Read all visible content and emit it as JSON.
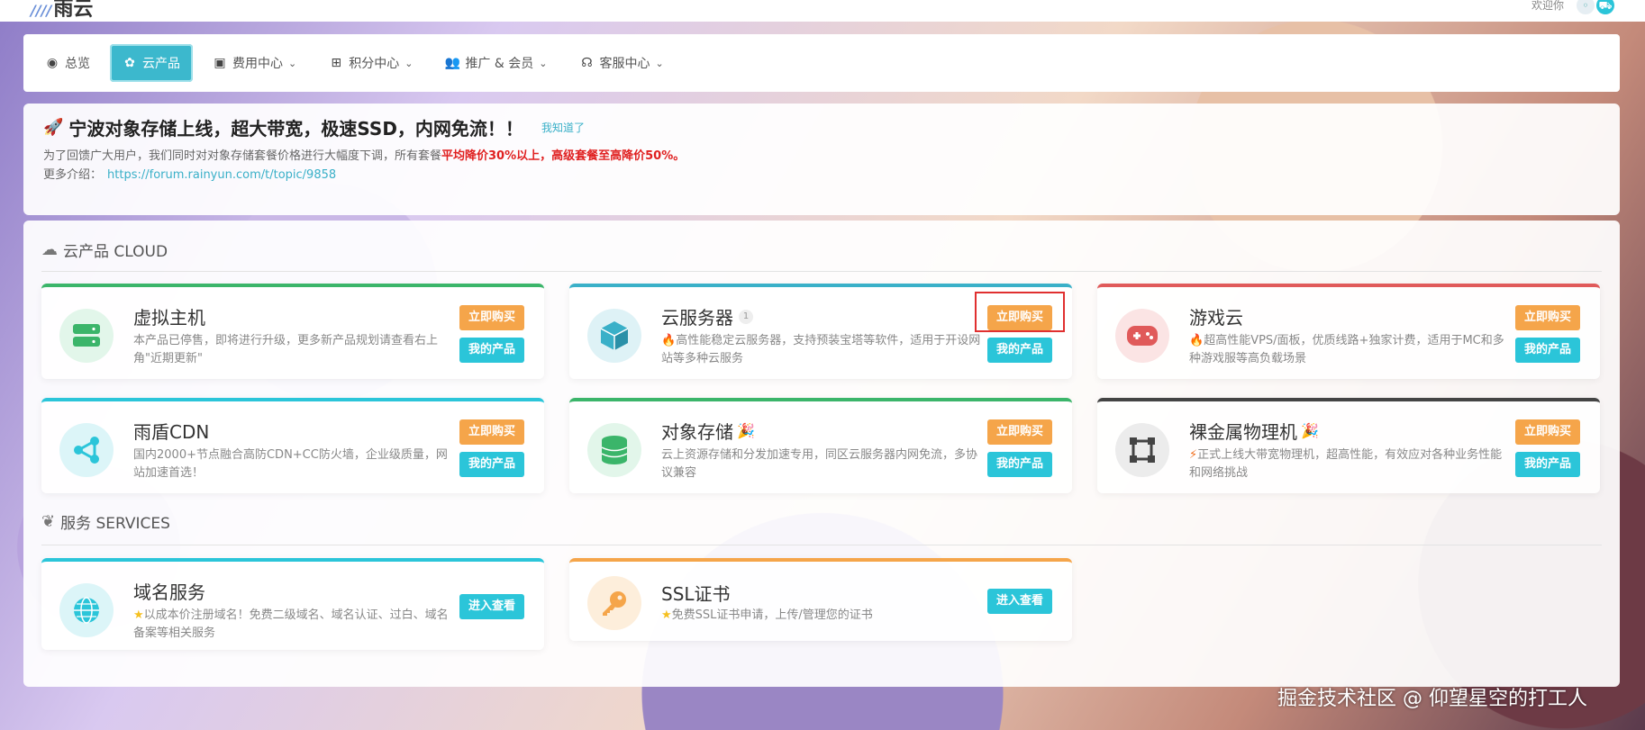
{
  "brand": {
    "logo_text": "雨云",
    "stripes": "////"
  },
  "header": {
    "welcome": "欢迎你"
  },
  "nav": {
    "items": [
      {
        "label": "总览",
        "icon": "dashboard-icon",
        "chevron": false
      },
      {
        "label": "云产品",
        "icon": "cloud-products-icon",
        "chevron": false,
        "active": true
      },
      {
        "label": "费用中心",
        "icon": "money-icon",
        "chevron": true
      },
      {
        "label": "积分中心",
        "icon": "gift-icon",
        "chevron": true
      },
      {
        "label": "推广 & 会员",
        "icon": "users-icon",
        "chevron": true
      },
      {
        "label": "客服中心",
        "icon": "headset-icon",
        "chevron": true
      }
    ]
  },
  "notice": {
    "title": "宁波对象存储上线，超大带宽，极速SSD，内网免流！！",
    "dismiss": "我知道了",
    "line1_prefix": "为了回馈广大用户，我们同时对对象存储套餐价格进行大幅度下调，所有套餐",
    "line1_highlight": "平均降价30%以上，高级套餐至高降价50%。",
    "line2_prefix": "更多介绍：",
    "line2_link": "https://forum.rainyun.com/t/topic/9858"
  },
  "sections": {
    "cloud_title": "云产品 CLOUD",
    "services_title": "服务 SERVICES"
  },
  "buttons": {
    "buy": "立即购买",
    "mine": "我的产品",
    "view": "进入查看"
  },
  "products": [
    {
      "name": "虚拟主机",
      "desc": "本产品已停售，即将进行升级，更多新产品规划请查看右上角\"近期更新\"",
      "icon": "server-icon",
      "accent": "#3bb56a"
    },
    {
      "name": "云服务器",
      "badge": "1",
      "desc": "高性能稳定云服务器，支持预装宝塔等软件，适用于开设网站等多种云服务",
      "icon": "cube-icon",
      "accent": "#3ab0c8"
    },
    {
      "name": "游戏云",
      "desc": "超高性能VPS/面板，优质线路+独家计费，适用于MC和多种游戏服等高负载场景",
      "icon": "gamepad-icon",
      "accent": "#e05a5a"
    },
    {
      "name": "雨盾CDN",
      "desc": "国内2000+节点融合高防CDN+CC防火墙，企业级质量，网站加速首选！",
      "icon": "share-nodes-icon",
      "accent": "#2bc5d9"
    },
    {
      "name": "对象存储",
      "desc": "云上资源存储和分发加速专用，同区云服务器内网免流，多协议兼容",
      "icon": "database-icon",
      "accent": "#3bb56a"
    },
    {
      "name": "裸金属物理机",
      "desc": "正式上线大带宽物理机，超高性能，有效应对各种业务性能和网络挑战",
      "icon": "vector-square-icon",
      "accent": "#444444"
    }
  ],
  "services": [
    {
      "name": "域名服务",
      "desc": "以成本价注册域名！免费二级域名、域名认证、过白、域名备案等相关服务",
      "icon": "globe-icon",
      "accent": "#2bc5d9"
    },
    {
      "name": "SSL证书",
      "desc": "免费SSL证书申请，上传/管理您的证书",
      "icon": "key-icon",
      "accent": "#f5a54a"
    }
  ],
  "watermark": "掘金技术社区 @ 仰望星空的打工人"
}
